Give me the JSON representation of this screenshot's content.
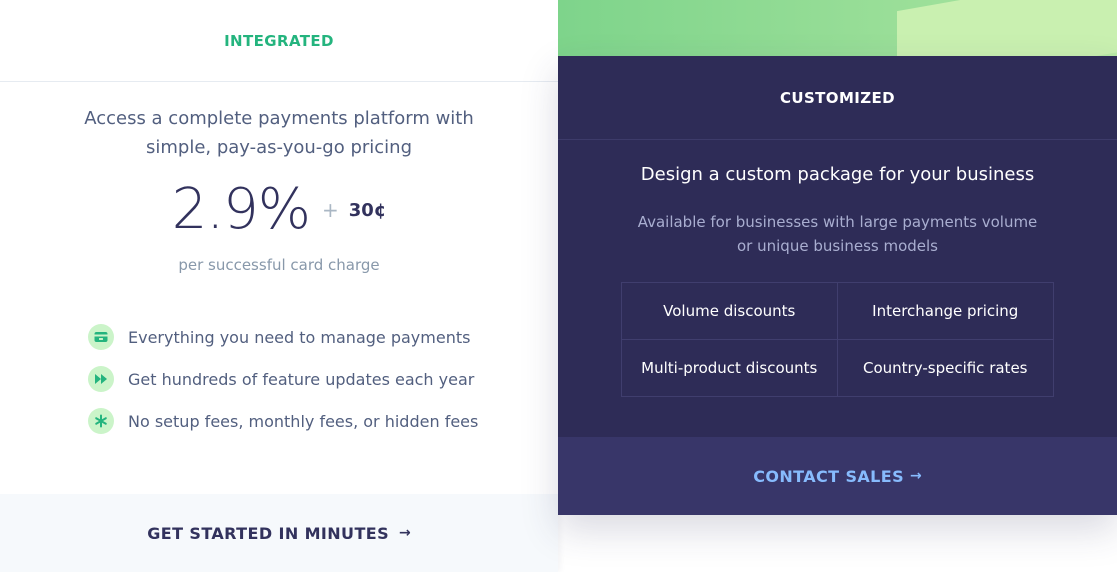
{
  "integrated": {
    "heading": "INTEGRATED",
    "description_line1": "Access a complete payments platform with",
    "description_line2": "simple, pay-as-you-go pricing",
    "price_percent": "2.9%",
    "price_plus": "+",
    "price_cents": "30¢",
    "price_note": "per successful card charge",
    "features": [
      {
        "icon": "payments-card-icon",
        "text": "Everything you need to manage payments"
      },
      {
        "icon": "fast-forward-icon",
        "text": "Get hundreds of feature updates each year"
      },
      {
        "icon": "asterisk-icon",
        "text": "No setup fees, monthly fees, or hidden fees"
      }
    ],
    "cta_label": "GET STARTED IN MINUTES",
    "cta_arrow": "→"
  },
  "customized": {
    "heading": "CUSTOMIZED",
    "title": "Design a custom package for your business",
    "subtitle_line1": "Available for businesses with large payments volume",
    "subtitle_line2": "or unique business models",
    "options": [
      "Volume discounts",
      "Interchange pricing",
      "Multi-product discounts",
      "Country-specific rates"
    ],
    "cta_label": "CONTACT SALES",
    "cta_arrow": "→"
  },
  "colors": {
    "accent_green": "#24b47e",
    "dark_navy": "#2e2c57",
    "link_blue": "#87bbfd",
    "icon_bg": "#cbf4c9"
  }
}
